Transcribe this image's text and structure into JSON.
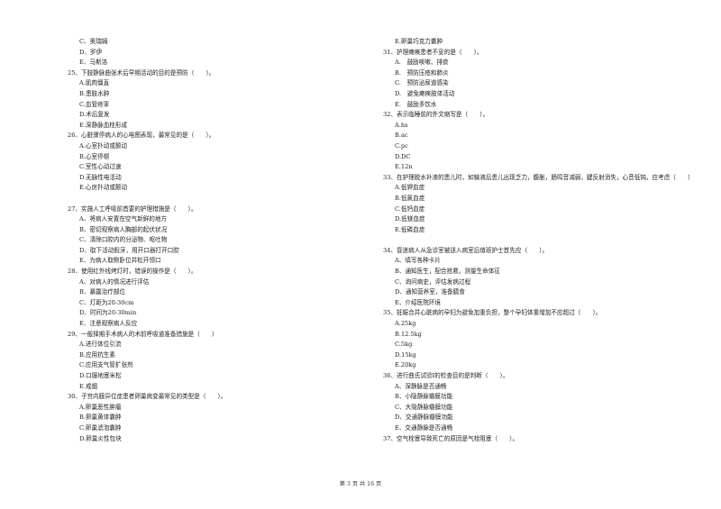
{
  "left_column": {
    "continued_options": [
      "C、奥瑞姆",
      "D、罗伊",
      "E、马斯洛"
    ],
    "questions": [
      {
        "number": "25",
        "text": "25、下肢静脉曲张术后早期活动的目的是预防（　　）。",
        "options": [
          "A.肌肉僵直",
          "B.患肢水肿",
          "C.血管痉挛",
          "D.术后复发",
          "E.深静脉血栓形成"
        ]
      },
      {
        "number": "26",
        "text": "26、心脏骤停病人的心电图表现，最常见的是（　　）。",
        "options": [
          "A.心室扑动或颤动",
          "B.心室停顿",
          "C.室性心动过速",
          "D.无脉性电活动",
          "E.心房扑动或颤动"
        ]
      },
      {
        "number": "27",
        "text": "27、实施人工呼吸前首要的护理措施是（　　）。",
        "options": [
          "A、将病人安置在空气新鲜的地方",
          "B、密切观察病人胸部的起伏状况",
          "C、清除口腔内的分泌物、呕吐物",
          "D、取下活动假牙，用开口器打开口腔",
          "E、为病人取侧卧位并松开领口"
        ]
      },
      {
        "number": "28",
        "text": "28、使用红外线烤灯时，错误的操作是（　　）。",
        "options": [
          "A、对病人的情况进行评估",
          "B、暴露治疗部位",
          "C、灯距为20-30cm",
          "D、时间为20-30min",
          "E、注意观察病人反应"
        ]
      },
      {
        "number": "29",
        "text": "29、一般择期手术病人的术前呼吸道准备措施是（　　）",
        "options": [
          "A.进行体位引流",
          "B.应用抗生素",
          "C.应用支气管扩张剂",
          "D.口服地塞米松",
          "E.戒烟"
        ]
      },
      {
        "number": "30",
        "text": "30、子宫内膜异位症患者卵巢病变最常见的类型是（　　）。",
        "options": [
          "A.卵巢恶性肿瘤",
          "B.卵巢黄体囊肿",
          "C.卵巢滤泡囊肿",
          "D.卵巢炎性包块"
        ]
      }
    ]
  },
  "right_column": {
    "continued_options": [
      "E.卵巢巧克力囊肿"
    ],
    "questions": [
      {
        "number": "31",
        "text": "31、护理瘫痪患者不妥的是（　　）。",
        "options": [
          "A.　鼓励咳嗽、排痰",
          "B.　预防压疮和肺炎",
          "C.　预防泌尿道感染",
          "D.　避免瘫痪肢体活动",
          "E.　鼓励多饮水"
        ]
      },
      {
        "number": "32",
        "text": "32、表示临睡前的外文缩写是（　　）。",
        "options": [
          "A.hs",
          "B.ac",
          "C.pc",
          "D.DC",
          "E.12n"
        ]
      },
      {
        "number": "33",
        "text": "33、在护理脱水补液的患儿时，如输液后患儿出现乏力，腹胀，肠鸣音减弱，腱反射消失，心音低钝，应考虑（　　）",
        "options": [
          "A.低钾血症",
          "B.低氯血症",
          "C.低钙血症",
          "D.低镁血症",
          "E.低磷血症"
        ]
      },
      {
        "number": "34",
        "text": "34、昏迷病人从急诊室被送入病室后值班护士首先应（　　）。",
        "options": [
          "A、填写各种卡片",
          "B、通知医生，配合抢救，测量生命体征",
          "C、询问病史，评估发病过程",
          "D、通知营养室，准备膳食",
          "E、介绍医院环境"
        ]
      },
      {
        "number": "35",
        "text": "35、妊娠合并心脏病的孕妇为避免加重负担，整个孕妇体重增加不应超过（　　）。",
        "options": [
          "A.25kg",
          "B.12.5kg",
          "C.5kg",
          "D.15kg",
          "E.20kg"
        ]
      },
      {
        "number": "36",
        "text": "36、进行曲氏试验I的检查目的是判断（　　）。",
        "options": [
          "A、深静脉是否通畅",
          "B、小隐静脉瓣膜功能",
          "C、大隐静脉瓣膜功能",
          "D、交通静脉瓣膜功能",
          "E、交通静脉是否通畅"
        ]
      },
      {
        "number": "37",
        "text": "37、空气栓塞导致死亡的原因是气栓阻塞（　　）。",
        "options": []
      }
    ]
  },
  "footer": {
    "page_label": "第 3 页 共 16 页"
  }
}
